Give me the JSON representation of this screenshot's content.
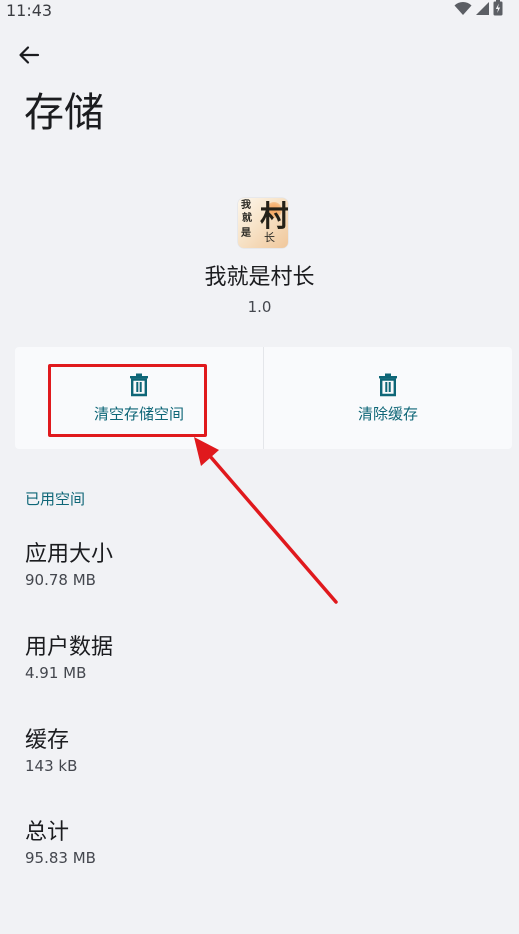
{
  "status_bar": {
    "time": "11:43",
    "icons": [
      "wifi-icon",
      "signal-icon",
      "battery-charging-icon"
    ]
  },
  "header": {
    "back_icon": "arrow-left-icon",
    "title": "存储"
  },
  "app": {
    "name": "我就是村长",
    "version": "1.0",
    "icon_glyphs": {
      "big": "村",
      "small_1": "我",
      "small_2": "就",
      "small_3": "是",
      "small_4": "长"
    }
  },
  "actions": [
    {
      "label": "清空存储空间",
      "icon": "trash-icon"
    },
    {
      "label": "清除缓存",
      "icon": "trash-icon"
    }
  ],
  "section": {
    "header": "已用空间",
    "items": [
      {
        "title": "应用大小",
        "value": "90.78 MB"
      },
      {
        "title": "用户数据",
        "value": "4.91 MB"
      },
      {
        "title": "缓存",
        "value": "143 kB"
      },
      {
        "title": "总计",
        "value": "95.83 MB"
      }
    ]
  },
  "colors": {
    "background": "#f1f2f5",
    "accent": "#0e6677",
    "annotation": "#e0191d"
  }
}
